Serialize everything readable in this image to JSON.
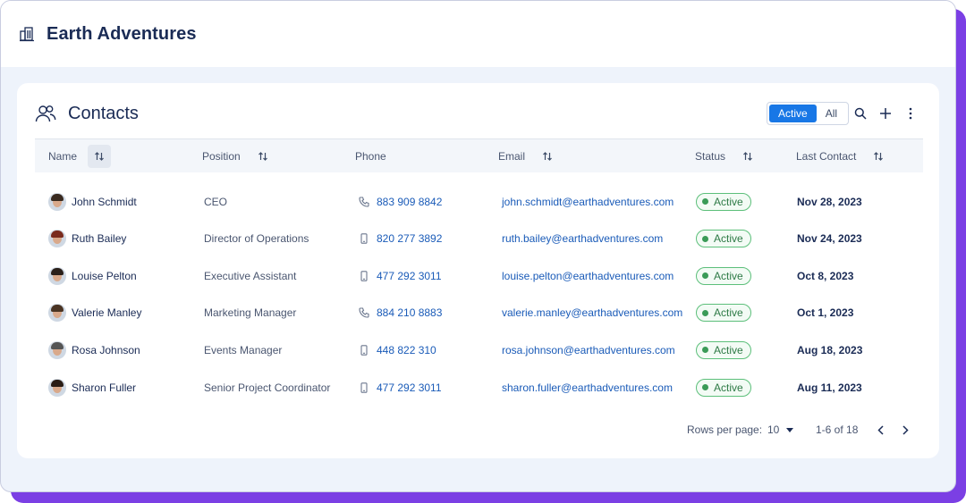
{
  "app": {
    "title": "Earth Adventures",
    "icon": "building-icon",
    "accent_shadow": "#7b3fe4"
  },
  "contacts": {
    "title": "Contacts",
    "icon": "people-icon",
    "filter": {
      "options": [
        "Active",
        "All"
      ],
      "selected": "Active",
      "selected_color": "#1877e6"
    },
    "toolbar_icons": [
      "search-icon",
      "plus-icon",
      "more-vertical-icon"
    ],
    "columns": [
      "Name",
      "Position",
      "Phone",
      "Email",
      "Status",
      "Last Contact"
    ],
    "rows": [
      {
        "name": "John Schmidt",
        "position": "CEO",
        "phone": "883 909 8842",
        "phone_icon": "phone-icon",
        "email": "john.schmidt@earthadventures.com",
        "status": "Active",
        "last_contact": "Nov 28, 2023"
      },
      {
        "name": "Ruth Bailey",
        "position": "Director of Operations",
        "phone": "820 277 3892",
        "phone_icon": "mobile-icon",
        "email": "ruth.bailey@earthadventures.com",
        "status": "Active",
        "last_contact": "Nov 24, 2023"
      },
      {
        "name": "Louise Pelton",
        "position": "Executive Assistant",
        "phone": "477 292 3011",
        "phone_icon": "mobile-icon",
        "email": "louise.pelton@earthadventures.com",
        "status": "Active",
        "last_contact": "Oct 8, 2023"
      },
      {
        "name": "Valerie Manley",
        "position": "Marketing Manager",
        "phone": "884 210 8883",
        "phone_icon": "phone-icon",
        "email": "valerie.manley@earthadventures.com",
        "status": "Active",
        "last_contact": "Oct 1, 2023"
      },
      {
        "name": "Rosa Johnson",
        "position": "Events Manager",
        "phone": "448 822 310",
        "phone_icon": "mobile-icon",
        "email": "rosa.johnson@earthadventures.com",
        "status": "Active",
        "last_contact": "Aug 18, 2023"
      },
      {
        "name": "Sharon Fuller",
        "position": "Senior Project Coordinator",
        "phone": "477 292 3011",
        "phone_icon": "mobile-icon",
        "email": "sharon.fuller@earthadventures.com",
        "status": "Active",
        "last_contact": "Aug 11, 2023"
      }
    ],
    "status_color": "#3a9b57",
    "pagination": {
      "rows_per_page_label": "Rows per page:",
      "rows_per_page": "10",
      "range": "1-6 of 18"
    }
  }
}
